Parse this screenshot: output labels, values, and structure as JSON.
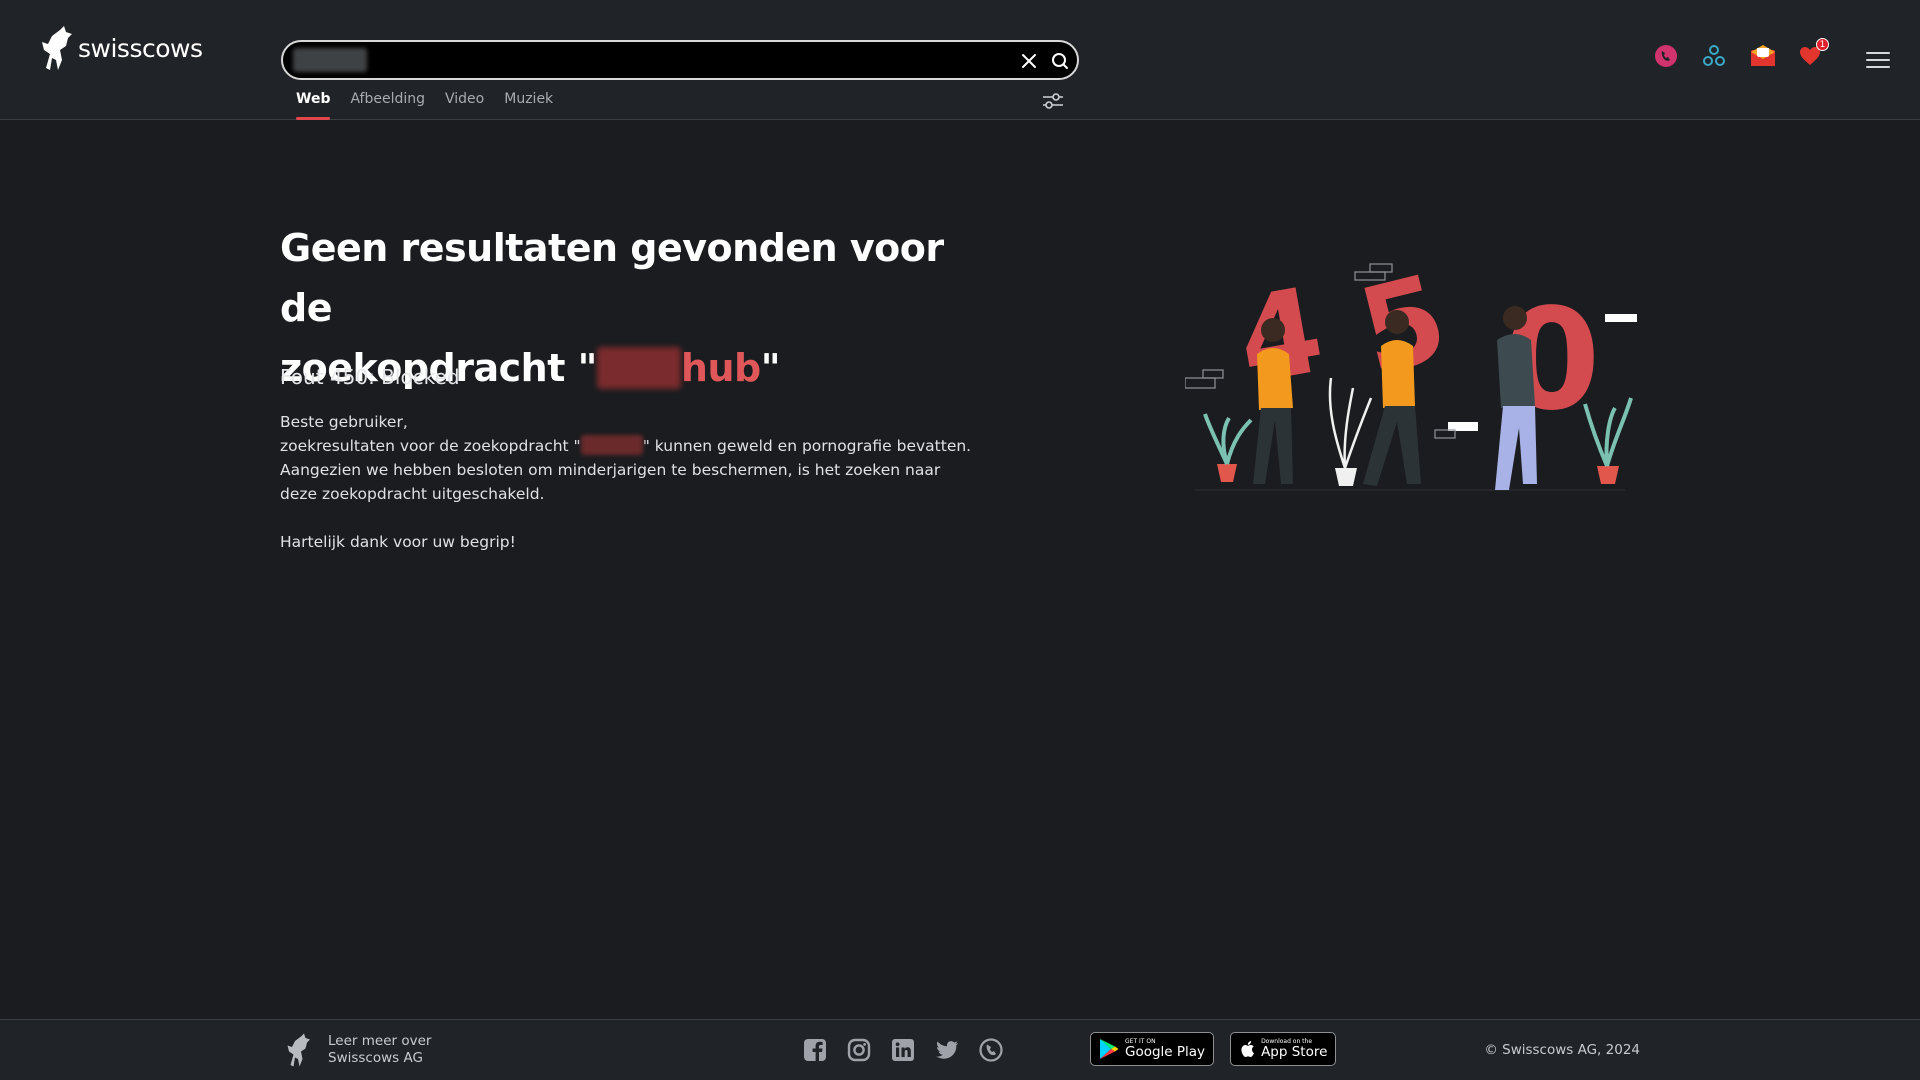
{
  "app": {
    "logo_text": "swisscows"
  },
  "search": {
    "value": "",
    "placeholder": ""
  },
  "tabs": [
    {
      "label": "Web",
      "active": true
    },
    {
      "label": "Afbeelding",
      "active": false
    },
    {
      "label": "Video",
      "active": false
    },
    {
      "label": "Muziek",
      "active": false
    }
  ],
  "header_icons": {
    "vpn": "teleguard-icon",
    "share": "network-icon",
    "mail": "mail-icon",
    "favorites": "heart-icon",
    "favorites_badge": "1"
  },
  "error": {
    "title_line1": "Geen resultaten gevonden voor de",
    "title_prefix": "zoekopdracht \"",
    "query_visible": "hub",
    "title_suffix": "\"",
    "code": "Fout 450: Blocked",
    "greeting": "Beste gebruiker,",
    "line1_prefix": "zoekresultaten voor de zoekopdracht \"",
    "line1_suffix": "\" kunnen geweld en pornografie bevatten.",
    "line2": "Aangezien we hebben besloten om minderjarigen te beschermen, is het zoeken naar deze zoekopdracht uitgeschakeld.",
    "thanks": "Hartelijk dank voor uw begrip!"
  },
  "illustration": {
    "digits": [
      "4",
      "5",
      "0"
    ]
  },
  "footer": {
    "about_line1": "Leer meer over",
    "about_line2": "Swisscows AG",
    "google_small": "GET IT ON",
    "google_big": "Google Play",
    "apple_small": "Download on the",
    "apple_big": "App Store",
    "copyright": "© Swisscows AG, 2024"
  },
  "colors": {
    "accent": "#e2474b",
    "background": "#1a1c1f",
    "header": "#202327"
  }
}
